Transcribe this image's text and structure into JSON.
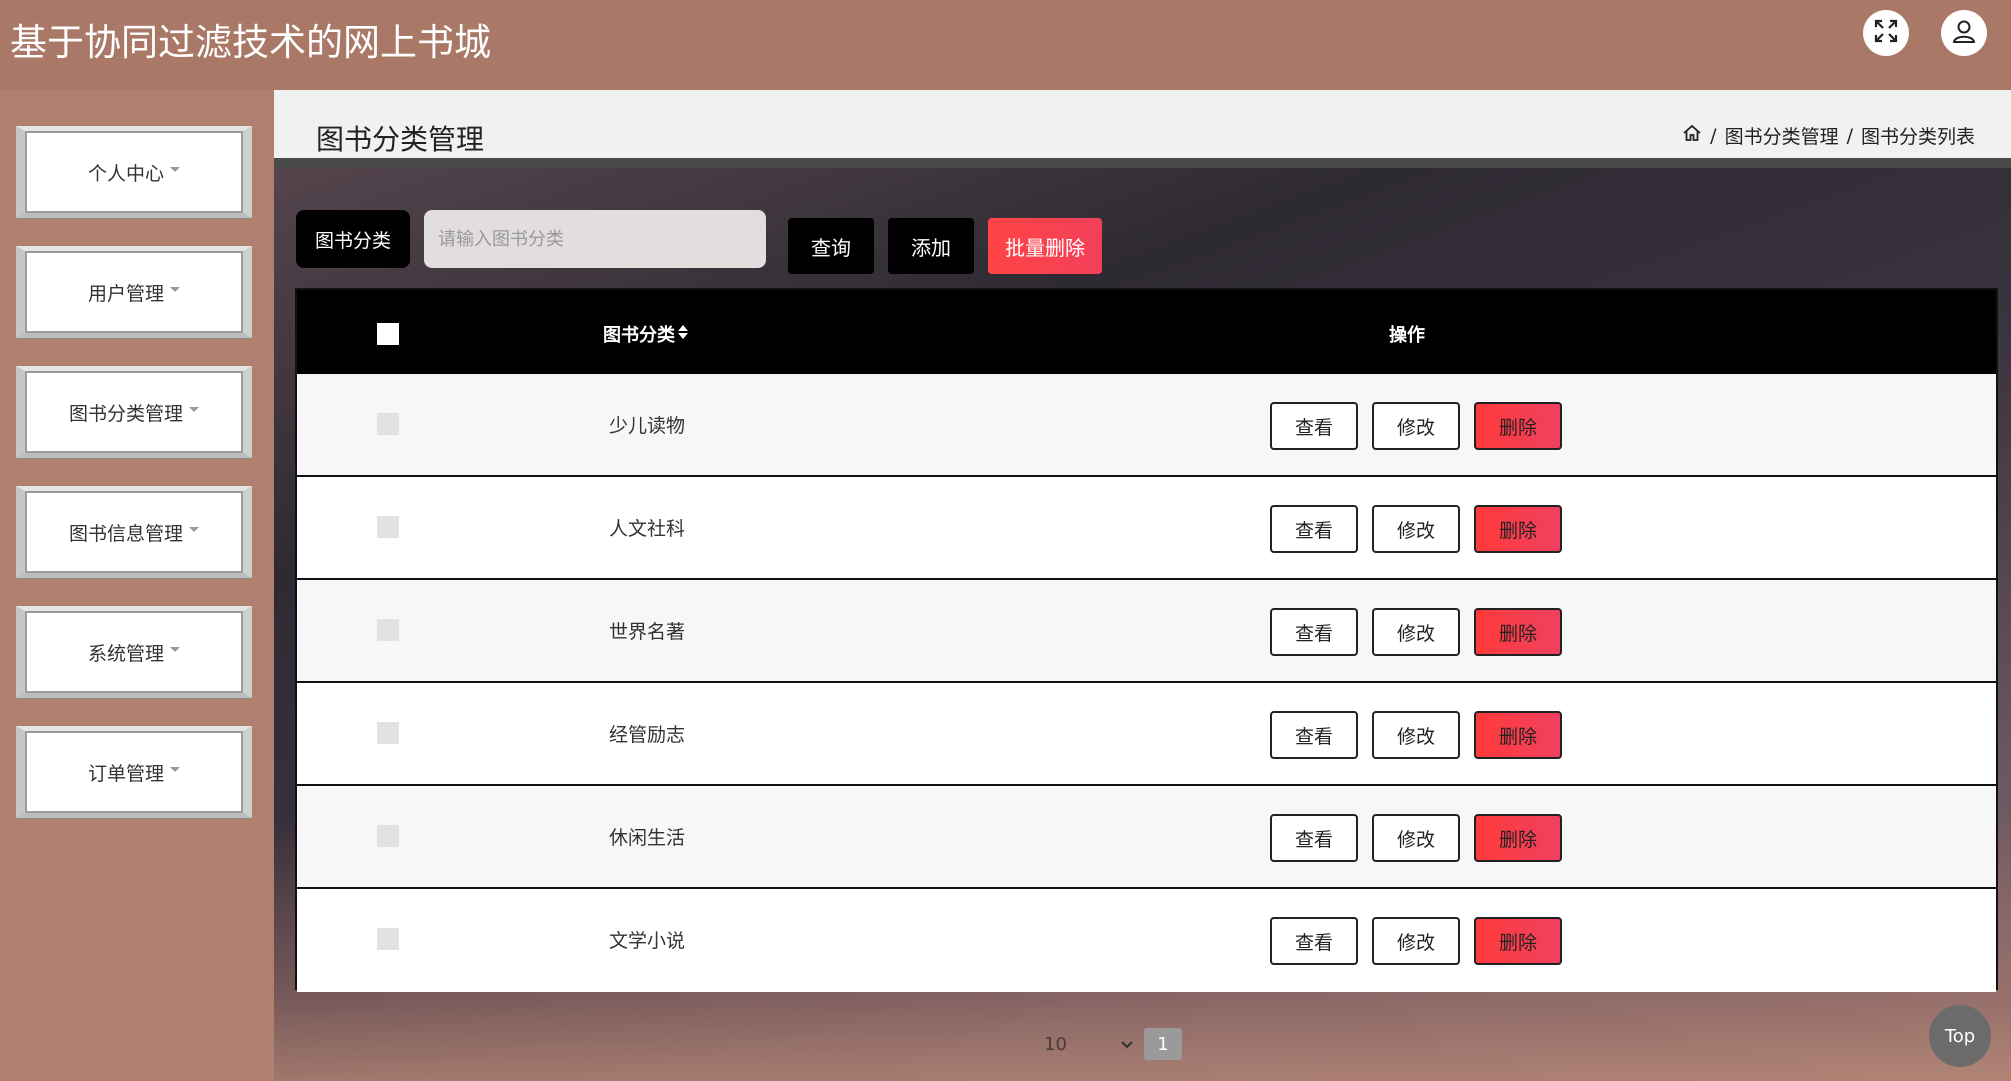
{
  "header": {
    "app_title": "基于协同过滤技术的网上书城",
    "fullscreen_icon": "fullscreen-icon",
    "user_icon": "user-icon"
  },
  "sidebar": {
    "items": [
      {
        "label": "个人中心"
      },
      {
        "label": "用户管理"
      },
      {
        "label": "图书分类管理"
      },
      {
        "label": "图书信息管理"
      },
      {
        "label": "系统管理"
      },
      {
        "label": "订单管理"
      }
    ]
  },
  "page": {
    "title": "图书分类管理",
    "breadcrumb": [
      "图书分类管理",
      "图书分类列表"
    ],
    "breadcrumb_sep": "/"
  },
  "search": {
    "label": "图书分类",
    "placeholder": "请输入图书分类",
    "query_label": "查询",
    "add_label": "添加",
    "batch_delete_label": "批量删除"
  },
  "table": {
    "columns": [
      "图书分类",
      "操作"
    ],
    "sort_icon": "sort-icon",
    "rows": [
      {
        "name": "少儿读物"
      },
      {
        "name": "人文社科"
      },
      {
        "name": "世界名著"
      },
      {
        "name": "经管励志"
      },
      {
        "name": "休闲生活"
      },
      {
        "name": "文学小说"
      }
    ],
    "actions": {
      "view": "查看",
      "edit": "修改",
      "delete": "删除"
    }
  },
  "pagination": {
    "page_size": "10",
    "current_page": "1"
  },
  "back_to_top": "Top",
  "colors": {
    "header_bg": "#a97867",
    "accent_red": "#ff4444",
    "button_black": "#000000"
  }
}
